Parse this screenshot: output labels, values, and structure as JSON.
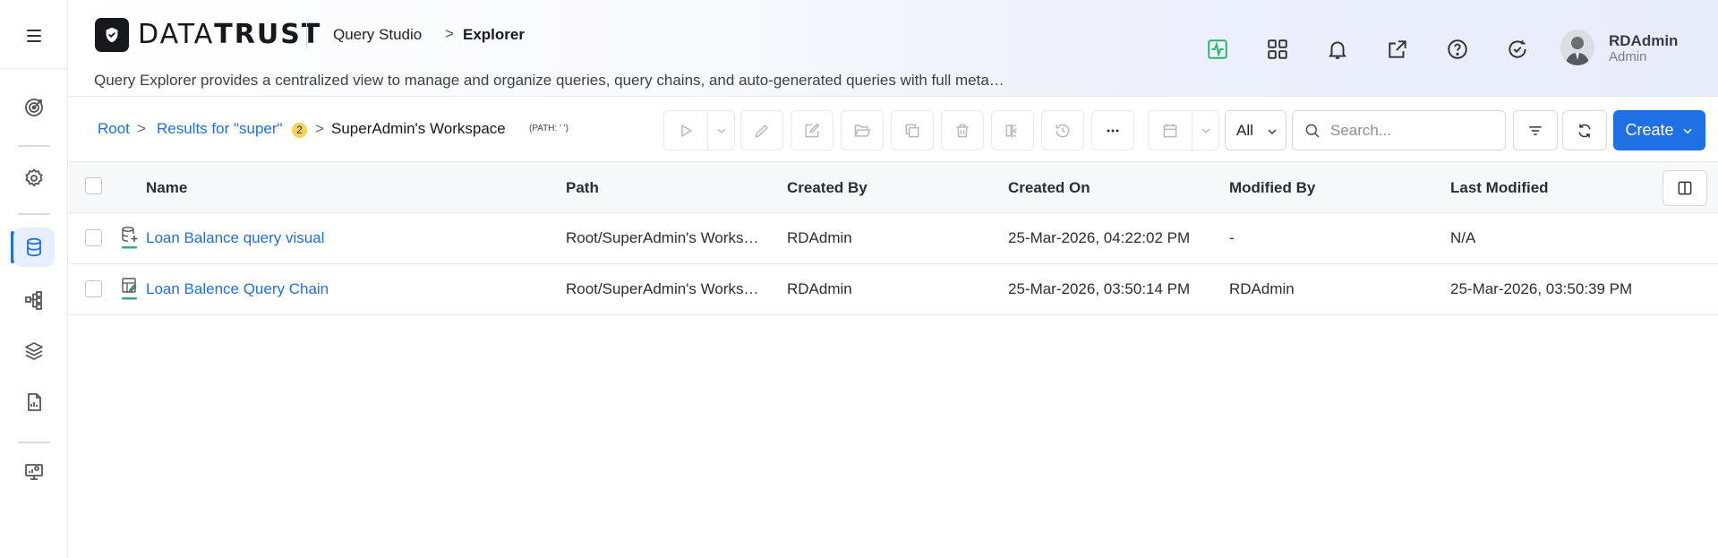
{
  "sidebar": {
    "items": [
      {
        "name": "menu-icon"
      },
      {
        "name": "target-icon"
      },
      {
        "name": "gear-icon"
      },
      {
        "name": "database-icon"
      },
      {
        "name": "flow-icon"
      },
      {
        "name": "layers-icon"
      },
      {
        "name": "report-icon"
      },
      {
        "name": "monitor-settings-icon"
      }
    ],
    "active_color": "#1f6fe5"
  },
  "header": {
    "logo_light": "DATA",
    "logo_bold": "TRUST",
    "breadcrumb_parent": "Query Studio",
    "breadcrumb_separator": ">",
    "breadcrumb_current": "Explorer",
    "description": "Query Explorer provides a centralized view to manage and organize queries, query chains, and auto-generated queries with full meta…",
    "icons": [
      "activity-icon",
      "apps-grid-icon",
      "bell-icon",
      "external-link-icon",
      "help-icon",
      "refresh-check-icon"
    ],
    "user": {
      "name": "RDAdmin",
      "role": "Admin"
    }
  },
  "toolbar": {
    "breadcrumb": {
      "root": "Root",
      "results": "Results for \"super\"",
      "results_count": "2",
      "current": "SuperAdmin's Workspace",
      "path_hint": "(PATH: ' ')"
    },
    "filter_select": "All",
    "search_placeholder": "Search...",
    "create_label": "Create"
  },
  "table": {
    "columns": [
      "Name",
      "Path",
      "Created By",
      "Created On",
      "Modified By",
      "Last Modified"
    ],
    "rows": [
      {
        "name": "Loan Balance query visual",
        "type_icon": "query-visual-icon",
        "path": "Root/SuperAdmin's Works…",
        "created_by": "RDAdmin",
        "created_on": "25-Mar-2026, 04:22:02 PM",
        "modified_by": "-",
        "last_modified": "N/A"
      },
      {
        "name": "Loan Balence Query Chain",
        "type_icon": "query-chain-icon",
        "path": "Root/SuperAdmin's Works…",
        "created_by": "RDAdmin",
        "created_on": "25-Mar-2026, 03:50:14 PM",
        "modified_by": "RDAdmin",
        "last_modified": "25-Mar-2026, 03:50:39 PM"
      }
    ]
  },
  "colors": {
    "accent": "#1f6fe5",
    "badge": "#f6d25a",
    "status_green": "#2fb36b"
  }
}
